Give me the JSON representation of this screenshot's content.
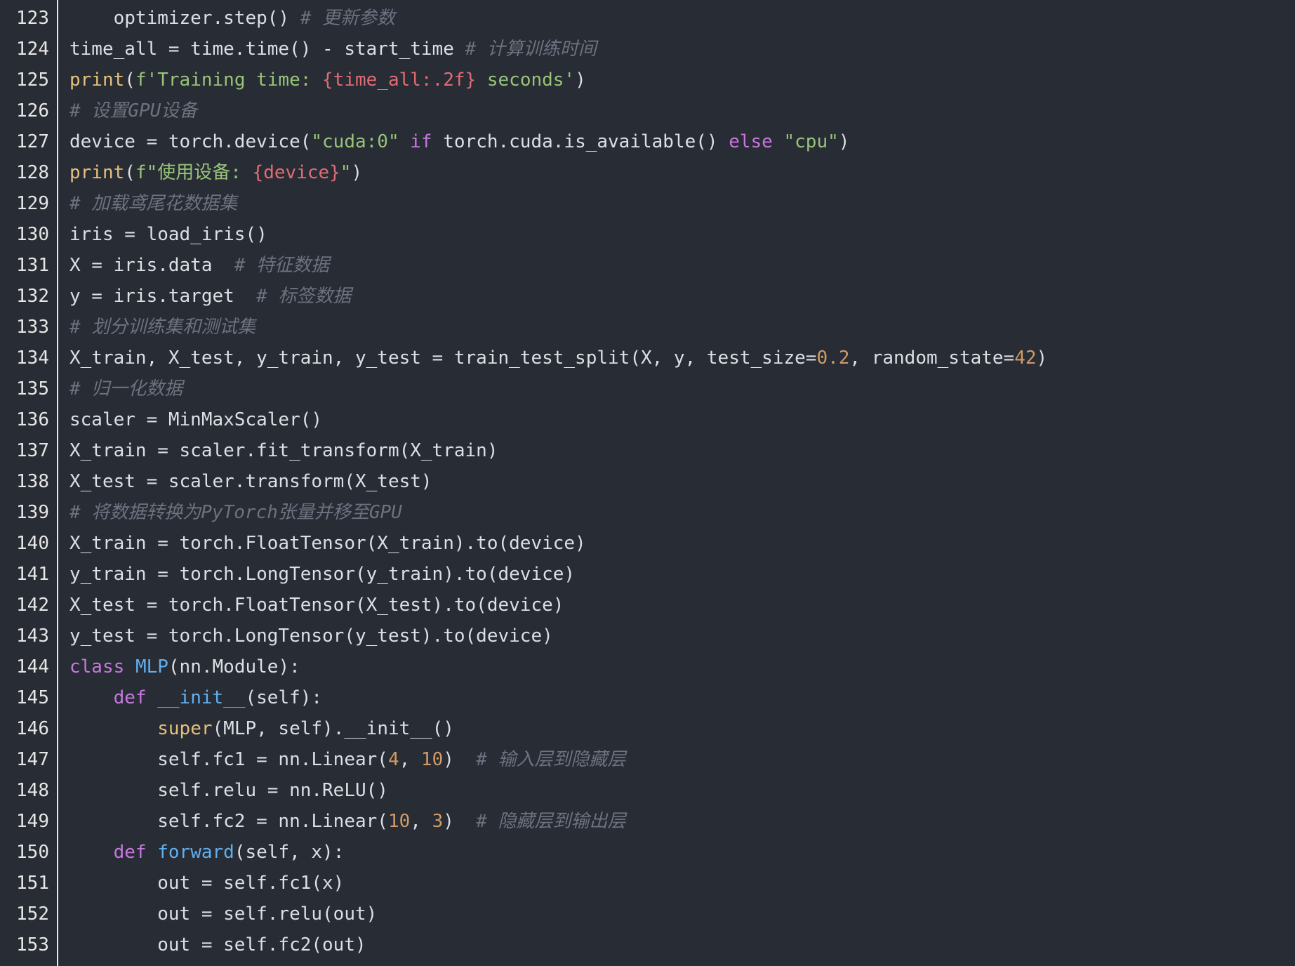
{
  "colors": {
    "background": "#282c34",
    "text": "#dcdfe4",
    "keyword": "#c678dd",
    "builtin": "#e5c07b",
    "string": "#98c379",
    "number": "#d19a66",
    "comment": "#6c7280",
    "function": "#61afef",
    "interpolation": "#e06c75",
    "gutter_divider": "#e8e8e8"
  },
  "lines": [
    {
      "n": "123",
      "tokens": [
        {
          "t": "    optimizer.step() ",
          "c": "plain"
        },
        {
          "t": "# 更新参数",
          "c": "comment"
        }
      ]
    },
    {
      "n": "124",
      "tokens": [
        {
          "t": "time_all = time.time() - start_time ",
          "c": "plain"
        },
        {
          "t": "# 计算训练时间",
          "c": "comment"
        }
      ]
    },
    {
      "n": "125",
      "tokens": [
        {
          "t": "print",
          "c": "builtin"
        },
        {
          "t": "(",
          "c": "plain"
        },
        {
          "t": "f'Training time: ",
          "c": "str"
        },
        {
          "t": "{time_all:.2f}",
          "c": "interp"
        },
        {
          "t": " seconds'",
          "c": "str"
        },
        {
          "t": ")",
          "c": "plain"
        }
      ]
    },
    {
      "n": "126",
      "tokens": [
        {
          "t": "# 设置GPU设备",
          "c": "comment"
        }
      ]
    },
    {
      "n": "127",
      "tokens": [
        {
          "t": "device = torch.device(",
          "c": "plain"
        },
        {
          "t": "\"cuda:0\"",
          "c": "str"
        },
        {
          "t": " ",
          "c": "plain"
        },
        {
          "t": "if",
          "c": "kw"
        },
        {
          "t": " torch.cuda.is_available() ",
          "c": "plain"
        },
        {
          "t": "else",
          "c": "kw"
        },
        {
          "t": " ",
          "c": "plain"
        },
        {
          "t": "\"cpu\"",
          "c": "str"
        },
        {
          "t": ")",
          "c": "plain"
        }
      ]
    },
    {
      "n": "128",
      "tokens": [
        {
          "t": "print",
          "c": "builtin"
        },
        {
          "t": "(",
          "c": "plain"
        },
        {
          "t": "f\"使用设备: ",
          "c": "str"
        },
        {
          "t": "{device}",
          "c": "interp"
        },
        {
          "t": "\"",
          "c": "str"
        },
        {
          "t": ")",
          "c": "plain"
        }
      ]
    },
    {
      "n": "129",
      "tokens": [
        {
          "t": "# 加载鸢尾花数据集",
          "c": "comment"
        }
      ]
    },
    {
      "n": "130",
      "tokens": [
        {
          "t": "iris = load_iris()",
          "c": "plain"
        }
      ]
    },
    {
      "n": "131",
      "tokens": [
        {
          "t": "X = iris.data  ",
          "c": "plain"
        },
        {
          "t": "# 特征数据",
          "c": "comment"
        }
      ]
    },
    {
      "n": "132",
      "tokens": [
        {
          "t": "y = iris.target  ",
          "c": "plain"
        },
        {
          "t": "# 标签数据",
          "c": "comment"
        }
      ]
    },
    {
      "n": "133",
      "tokens": [
        {
          "t": "# 划分训练集和测试集",
          "c": "comment"
        }
      ]
    },
    {
      "n": "134",
      "tokens": [
        {
          "t": "X_train, X_test, y_train, y_test = train_test_split(X, y, test_size=",
          "c": "plain"
        },
        {
          "t": "0.2",
          "c": "num"
        },
        {
          "t": ", random_state=",
          "c": "plain"
        },
        {
          "t": "42",
          "c": "num"
        },
        {
          "t": ")",
          "c": "plain"
        }
      ]
    },
    {
      "n": "135",
      "tokens": [
        {
          "t": "# 归一化数据",
          "c": "comment"
        }
      ]
    },
    {
      "n": "136",
      "tokens": [
        {
          "t": "scaler = MinMaxScaler()",
          "c": "plain"
        }
      ]
    },
    {
      "n": "137",
      "tokens": [
        {
          "t": "X_train = scaler.fit_transform(X_train)",
          "c": "plain"
        }
      ]
    },
    {
      "n": "138",
      "tokens": [
        {
          "t": "X_test = scaler.transform(X_test)",
          "c": "plain"
        }
      ]
    },
    {
      "n": "139",
      "tokens": [
        {
          "t": "# 将数据转换为PyTorch张量并移至GPU",
          "c": "comment"
        }
      ]
    },
    {
      "n": "140",
      "tokens": [
        {
          "t": "X_train = torch.FloatTensor(X_train).to(device)",
          "c": "plain"
        }
      ]
    },
    {
      "n": "141",
      "tokens": [
        {
          "t": "y_train = torch.LongTensor(y_train).to(device)",
          "c": "plain"
        }
      ]
    },
    {
      "n": "142",
      "tokens": [
        {
          "t": "X_test = torch.FloatTensor(X_test).to(device)",
          "c": "plain"
        }
      ]
    },
    {
      "n": "143",
      "tokens": [
        {
          "t": "y_test = torch.LongTensor(y_test).to(device)",
          "c": "plain"
        }
      ]
    },
    {
      "n": "144",
      "tokens": [
        {
          "t": "class",
          "c": "kw"
        },
        {
          "t": " ",
          "c": "plain"
        },
        {
          "t": "MLP",
          "c": "fn"
        },
        {
          "t": "(nn.Module):",
          "c": "plain"
        }
      ]
    },
    {
      "n": "145",
      "tokens": [
        {
          "t": "    ",
          "c": "plain"
        },
        {
          "t": "def",
          "c": "kw"
        },
        {
          "t": " ",
          "c": "plain"
        },
        {
          "t": "__init__",
          "c": "fn"
        },
        {
          "t": "(self):",
          "c": "plain"
        }
      ]
    },
    {
      "n": "146",
      "tokens": [
        {
          "t": "        ",
          "c": "plain"
        },
        {
          "t": "super",
          "c": "builtin"
        },
        {
          "t": "(MLP, self).__init__()",
          "c": "plain"
        }
      ]
    },
    {
      "n": "147",
      "tokens": [
        {
          "t": "        self.fc1 = nn.Linear(",
          "c": "plain"
        },
        {
          "t": "4",
          "c": "num"
        },
        {
          "t": ", ",
          "c": "plain"
        },
        {
          "t": "10",
          "c": "num"
        },
        {
          "t": ")  ",
          "c": "plain"
        },
        {
          "t": "# 输入层到隐藏层",
          "c": "comment"
        }
      ]
    },
    {
      "n": "148",
      "tokens": [
        {
          "t": "        self.relu = nn.ReLU()",
          "c": "plain"
        }
      ]
    },
    {
      "n": "149",
      "tokens": [
        {
          "t": "        self.fc2 = nn.Linear(",
          "c": "plain"
        },
        {
          "t": "10",
          "c": "num"
        },
        {
          "t": ", ",
          "c": "plain"
        },
        {
          "t": "3",
          "c": "num"
        },
        {
          "t": ")  ",
          "c": "plain"
        },
        {
          "t": "# 隐藏层到输出层",
          "c": "comment"
        }
      ]
    },
    {
      "n": "150",
      "tokens": [
        {
          "t": "    ",
          "c": "plain"
        },
        {
          "t": "def",
          "c": "kw"
        },
        {
          "t": " ",
          "c": "plain"
        },
        {
          "t": "forward",
          "c": "fn"
        },
        {
          "t": "(self, x):",
          "c": "plain"
        }
      ]
    },
    {
      "n": "151",
      "tokens": [
        {
          "t": "        out = self.fc1(x)",
          "c": "plain"
        }
      ]
    },
    {
      "n": "152",
      "tokens": [
        {
          "t": "        out = self.relu(out)",
          "c": "plain"
        }
      ]
    },
    {
      "n": "153",
      "tokens": [
        {
          "t": "        out = self.fc2(out)",
          "c": "plain"
        }
      ]
    }
  ]
}
